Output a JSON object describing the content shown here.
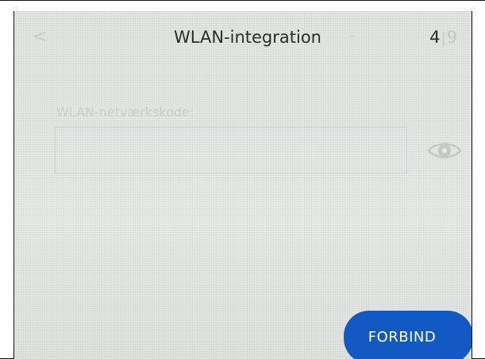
{
  "header": {
    "back_icon": "chevron-left-icon",
    "back_glyph": "<",
    "title": "WLAN-integration",
    "step": {
      "current": "4",
      "total": "9"
    }
  },
  "form": {
    "field_label": "WLAN-netværkskode:",
    "password_value": "",
    "visibility_icon": "eye-icon"
  },
  "actions": {
    "connect_label": "FORBIND"
  },
  "colors": {
    "accent": "#1359c4",
    "background": "#e6e8e6",
    "title_text": "#2a2c2d",
    "muted_text": "#cbcfcb"
  }
}
